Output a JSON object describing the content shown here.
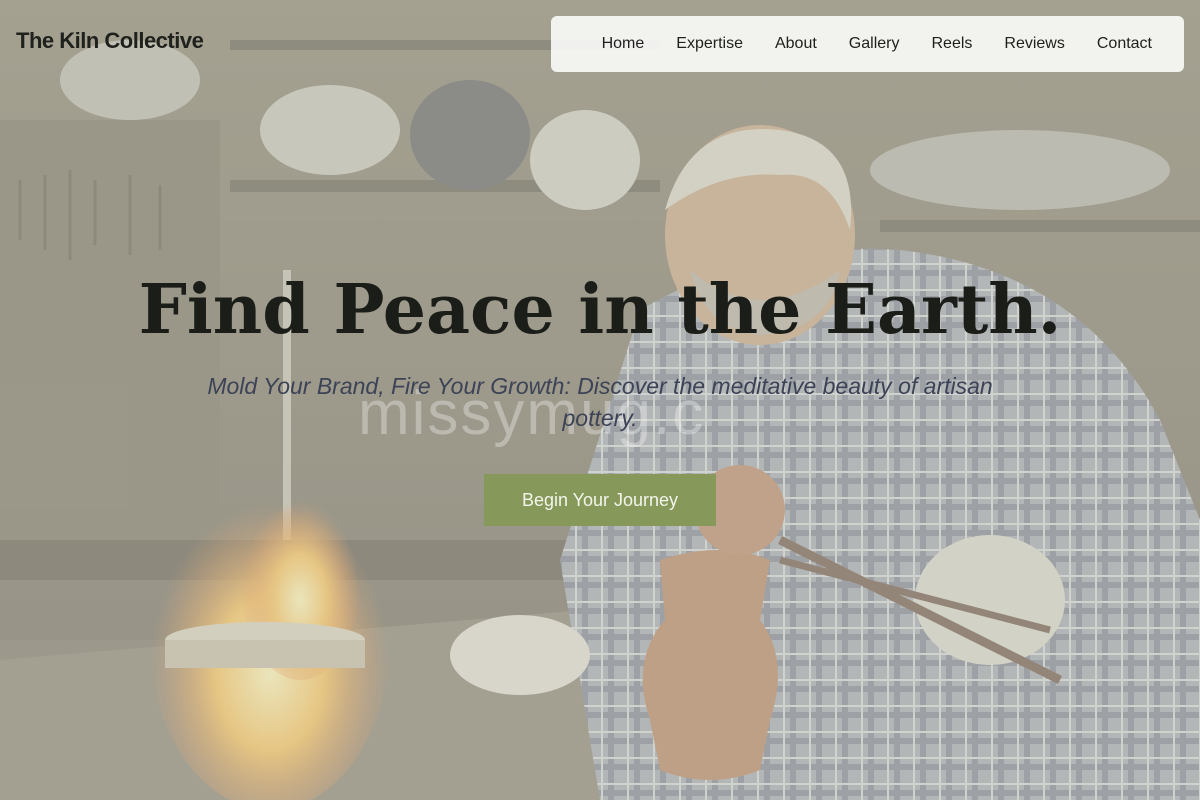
{
  "header": {
    "brand": "The Kiln Collective"
  },
  "nav": {
    "items": [
      {
        "label": "Home"
      },
      {
        "label": "Expertise"
      },
      {
        "label": "About"
      },
      {
        "label": "Gallery"
      },
      {
        "label": "Reels"
      },
      {
        "label": "Reviews"
      },
      {
        "label": "Contact"
      }
    ]
  },
  "hero": {
    "title": "Find Peace in the Earth.",
    "subtitle": "Mold Your Brand, Fire Your Growth: Discover the meditative beauty of artisan pottery.",
    "cta_label": "Begin Your Journey",
    "watermark": "missymug.c"
  },
  "colors": {
    "accent": "#87995a",
    "text_dark": "#1b1d18",
    "subtitle": "#3c4356",
    "nav_bg": "#f8f9f6"
  }
}
